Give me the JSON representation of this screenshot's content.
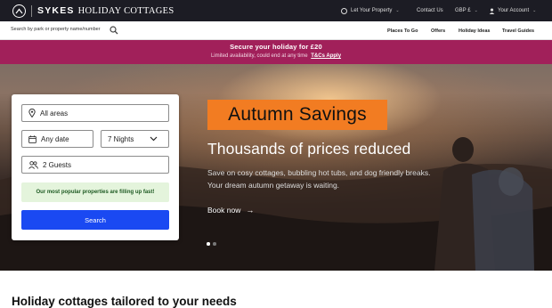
{
  "brand": {
    "name_bold": "SYKES",
    "name_rest": "HOLIDAY COTTAGES"
  },
  "topnav": {
    "let_property": "Let Your Property",
    "contact": "Contact Us",
    "currency": "GBP £",
    "account": "Your Account"
  },
  "search": {
    "placeholder": "Search by park or property name/number"
  },
  "mainnav": {
    "items": [
      "Places To Go",
      "Offers",
      "Holiday Ideas",
      "Travel Guides"
    ]
  },
  "promo": {
    "headline": "Secure your holiday for £20",
    "subtext": "Limited availability, could end at any time",
    "link": "T&Cs Apply"
  },
  "booking": {
    "location": "All areas",
    "date": "Any date",
    "nights": "7 Nights",
    "guests": "2 Guests",
    "notice": "Our most popular properties are filling up fast!",
    "search_label": "Search"
  },
  "hero": {
    "badge": "Autumn Savings",
    "heading": "Thousands of prices reduced",
    "line1": "Save on cosy cottages, bubbling hot tubs, and dog friendly breaks.",
    "line2": "Your dream autumn getaway is waiting.",
    "cta": "Book now",
    "slides_total": 2,
    "slide_active": 1
  },
  "section": {
    "heading": "Holiday cottages tailored to your needs"
  },
  "colors": {
    "topbar": "#1c1c24",
    "promo": "#a1205a",
    "badge": "#f27c22",
    "button": "#1a49f2",
    "notice_bg": "#e4f4dc"
  }
}
